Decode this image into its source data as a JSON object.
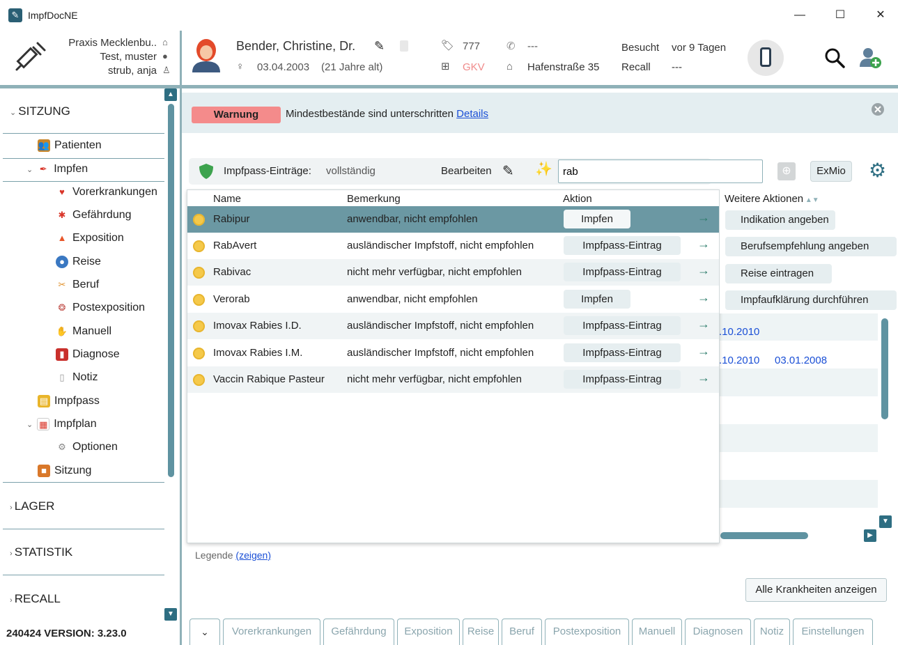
{
  "window": {
    "title": "ImpfDocNE",
    "minimize": "—",
    "maximize": "☐",
    "close": "✕"
  },
  "user": {
    "praxis": "Praxis Mecklenbu..",
    "test": "Test, muster",
    "user": "strub, anja"
  },
  "patient": {
    "name": "Bender, Christine, Dr.",
    "birth": "03.04.2003",
    "age": "(21 Jahre alt)",
    "tag": "777",
    "insurance": "GKV",
    "phone": "---",
    "address": "Hafenstraße 35",
    "besucht_label": "Besucht",
    "besucht_value": "vor 9 Tagen",
    "recall_label": "Recall",
    "recall_value": "---"
  },
  "sidebar": {
    "sitzung": "SITZUNG",
    "items": [
      {
        "label": "Patienten"
      },
      {
        "label": "Impfen"
      },
      {
        "label": "Vorerkrankungen"
      },
      {
        "label": "Gefährdung"
      },
      {
        "label": "Exposition"
      },
      {
        "label": "Reise"
      },
      {
        "label": "Beruf"
      },
      {
        "label": "Postexposition"
      },
      {
        "label": "Manuell"
      },
      {
        "label": "Diagnose"
      },
      {
        "label": "Notiz"
      },
      {
        "label": "Impfpass"
      },
      {
        "label": "Impfplan"
      },
      {
        "label": "Optionen"
      },
      {
        "label": "Sitzung"
      }
    ],
    "lager": "LAGER",
    "statistik": "STATISTIK",
    "recall": "RECALL",
    "version": "240424 VERSION: 3.23.0"
  },
  "warning": {
    "badge": "Warnung",
    "text": "Mindestbestände sind unterschritten",
    "link": "Details"
  },
  "impfpass": {
    "label": "Impfpass-Einträge:",
    "status": "vollständig",
    "edit": "Bearbeiten"
  },
  "search": {
    "value": "rab",
    "exmio": "ExMio"
  },
  "table": {
    "columns": {
      "name": "Name",
      "bemerkung": "Bemerkung",
      "aktion": "Aktion",
      "weitere": "Weitere Aktionen"
    },
    "rows": [
      {
        "name": "Rabipur",
        "bemerkung": "anwendbar, nicht empfohlen",
        "aktion": "Impfen"
      },
      {
        "name": "RabAvert",
        "bemerkung": "ausländischer Impfstoff, nicht empfohlen",
        "aktion": "Impfpass-Eintrag"
      },
      {
        "name": "Rabivac",
        "bemerkung": "nicht mehr verfügbar, nicht empfohlen",
        "aktion": "Impfpass-Eintrag"
      },
      {
        "name": "Verorab",
        "bemerkung": "anwendbar, nicht empfohlen",
        "aktion": "Impfen"
      },
      {
        "name": "Imovax Rabies I.D.",
        "bemerkung": "ausländischer Impfstoff, nicht empfohlen",
        "aktion": "Impfpass-Eintrag"
      },
      {
        "name": "Imovax Rabies I.M.",
        "bemerkung": "ausländischer Impfstoff, nicht empfohlen",
        "aktion": "Impfpass-Eintrag"
      },
      {
        "name": "Vaccin Rabique Pasteur",
        "bemerkung": "nicht mehr verfügbar, nicht empfohlen",
        "aktion": "Impfpass-Eintrag"
      }
    ],
    "weitere_aktionen": [
      "Indikation angeben",
      "Berufsempfehlung angeben",
      "Reise eintragen",
      "Impfaufklärung durchführen"
    ],
    "bg_dates": [
      ".10.2010",
      ".10.2010",
      "03.01.2008"
    ]
  },
  "legende": {
    "label": "Legende",
    "link": "(zeigen)"
  },
  "alle_button": "Alle Krankheiten anzeigen",
  "tabs": [
    "Vorerkrankungen",
    "Gefährdung",
    "Exposition",
    "Reise",
    "Beruf",
    "Postexposition",
    "Manuell",
    "Diagnosen",
    "Notiz",
    "Einstellungen"
  ],
  "colors": {
    "accent": "#8fb1b8",
    "selected_row": "#6b98a3",
    "warning": "#f48b8b",
    "link": "#1a4fd6"
  }
}
